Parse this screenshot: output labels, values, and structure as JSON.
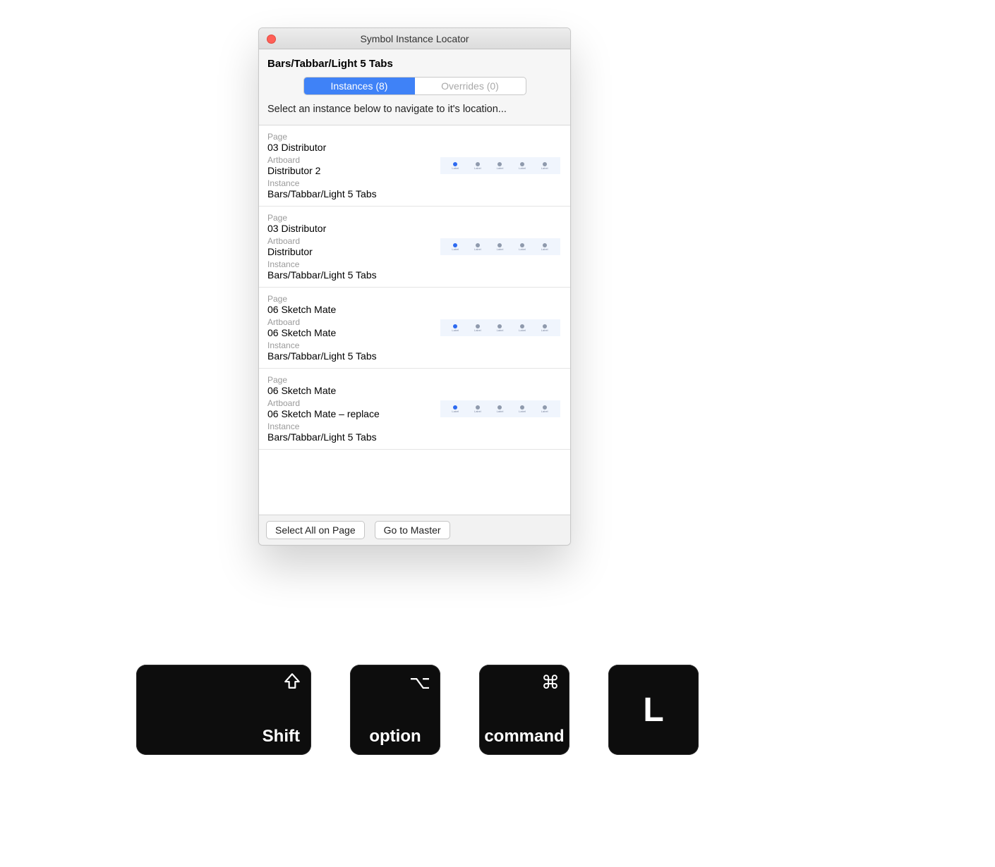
{
  "window": {
    "title": "Symbol Instance Locator",
    "symbol_name": "Bars/Tabbar/Light 5 Tabs",
    "tabs": {
      "instances": "Instances (8)",
      "overrides": "Overrides (0)"
    },
    "instruction": "Select an instance below to navigate to it's location...",
    "labels": {
      "page": "Page",
      "artboard": "Artboard",
      "instance": "Instance"
    },
    "rows": [
      {
        "page": "03 Distributor",
        "artboard": "Distributor 2",
        "instance": "Bars/Tabbar/Light 5 Tabs"
      },
      {
        "page": "03 Distributor",
        "artboard": "Distributor",
        "instance": "Bars/Tabbar/Light 5 Tabs"
      },
      {
        "page": "06 Sketch Mate",
        "artboard": "06 Sketch Mate",
        "instance": "Bars/Tabbar/Light 5 Tabs"
      },
      {
        "page": "06 Sketch Mate",
        "artboard": "06 Sketch Mate – replace",
        "instance": "Bars/Tabbar/Light 5 Tabs"
      }
    ],
    "footer": {
      "select_all": "Select All on Page",
      "go_to_master": "Go to Master"
    },
    "preview": {
      "tab_label": "Label"
    }
  },
  "keys": {
    "shift": {
      "symbol": "⇧",
      "label": "Shift"
    },
    "option": {
      "symbol": "⌥",
      "label": "option"
    },
    "command": {
      "symbol": "⌘",
      "label": "command"
    },
    "letter": "L"
  }
}
